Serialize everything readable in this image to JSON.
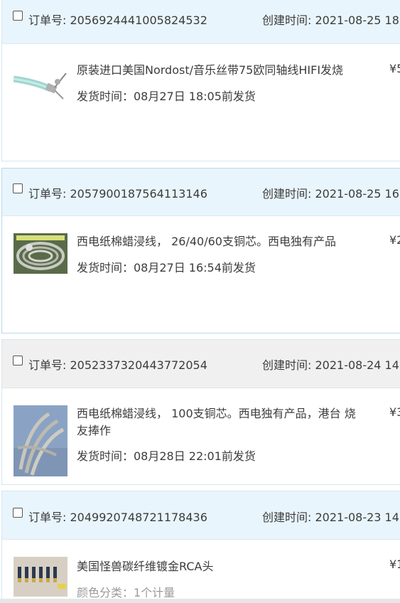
{
  "orders": [
    {
      "order_label": "订单号: 2056924441005824532",
      "created_label": "创建时间: 2021-08-25 18",
      "title": "原装进口美国Nordost/音乐丝带75欧同轴线HIFI发烧",
      "ship_line": "发货时间：08月27日 18:05前发货",
      "price_fragment": "¥5",
      "thumb_icon": "coaxial-cable-image",
      "header_color": "#e8f5fc"
    },
    {
      "order_label": "订单号: 2057900187564113146",
      "created_label": "创建时间: 2021-08-25 16",
      "title": "西电纸棉蜡浸线， 26/40/60支铜芯。西电独有产品",
      "ship_line": "发货时间：08月27日 16:54前发货",
      "price_fragment": "¥2",
      "thumb_icon": "wire-coil-image",
      "header_color": "#e8f5fc"
    },
    {
      "order_label": "订单号: 2052337320443772054",
      "created_label": "创建时间: 2021-08-24 14",
      "title": "西电纸棉蜡浸线， 100支铜芯。西电独有产品，港台 烧友捧作",
      "ship_line": "发货时间：08月28日 22:01前发货",
      "price_fragment": "¥3",
      "thumb_icon": "braided-cable-image",
      "header_color": "#f0f0f0"
    },
    {
      "order_label": "订单号: 2049920748721178436",
      "created_label": "创建时间: 2021-08-23 14",
      "title": "美国怪兽碳纤维镀金RCA头",
      "ship_line": "颜色分类：1个计量",
      "price_fragment": "¥1",
      "thumb_icon": "rca-connectors-image",
      "header_color": "#e8f5fc"
    }
  ]
}
